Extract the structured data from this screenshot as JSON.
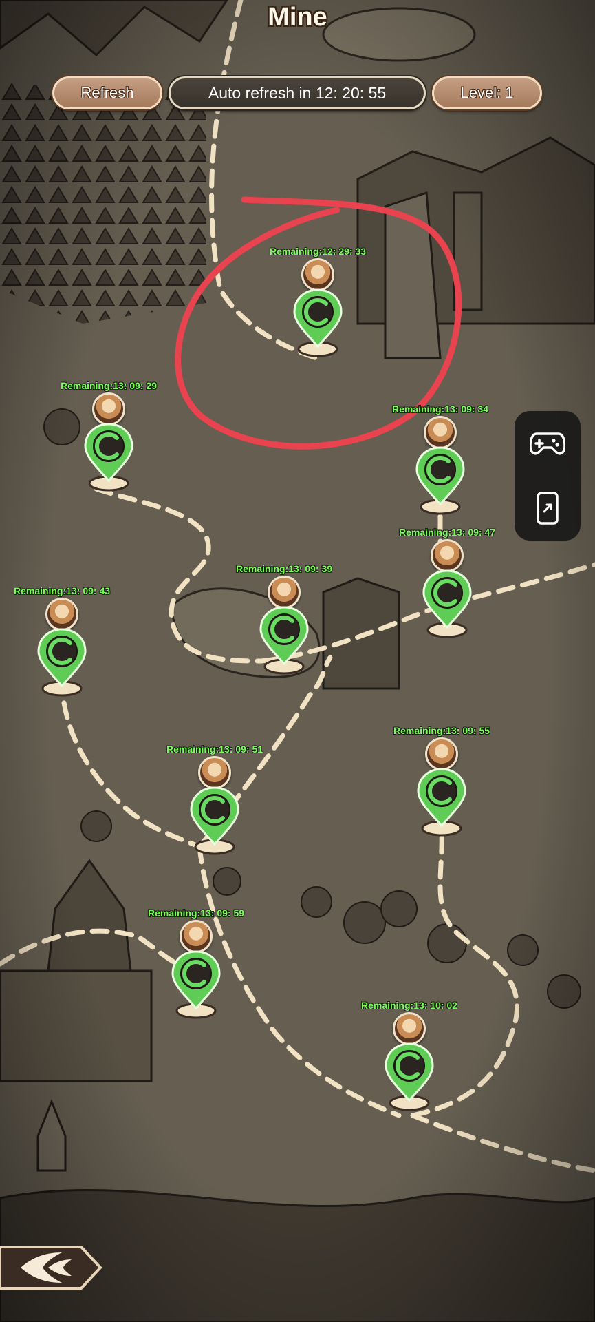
{
  "header": {
    "title": "Mine"
  },
  "toolbar": {
    "refresh_label": "Refresh",
    "auto_refresh_label": "Auto refresh in 12: 20: 55",
    "level_label": "Level: 1"
  },
  "nodes": [
    {
      "remaining": "Remaining:12: 29: 33"
    },
    {
      "remaining": "Remaining:13: 09: 29"
    },
    {
      "remaining": "Remaining:13: 09: 34"
    },
    {
      "remaining": "Remaining:13: 09: 47"
    },
    {
      "remaining": "Remaining:13: 09: 39"
    },
    {
      "remaining": "Remaining:13: 09: 43"
    },
    {
      "remaining": "Remaining:13: 09: 55"
    },
    {
      "remaining": "Remaining:13: 09: 51"
    },
    {
      "remaining": "Remaining:13: 09: 59"
    },
    {
      "remaining": "Remaining:13: 10: 02"
    }
  ],
  "side_panel": {
    "icons": [
      "gamepad-icon",
      "phone-rotate-icon"
    ]
  },
  "colors": {
    "timer_text": "#79ff52",
    "marker_green": "#5fcc55",
    "highlight_red": "#e8434e",
    "path_cream": "#f2e2c4"
  },
  "icons": {
    "back": "back-arrow-icon"
  }
}
